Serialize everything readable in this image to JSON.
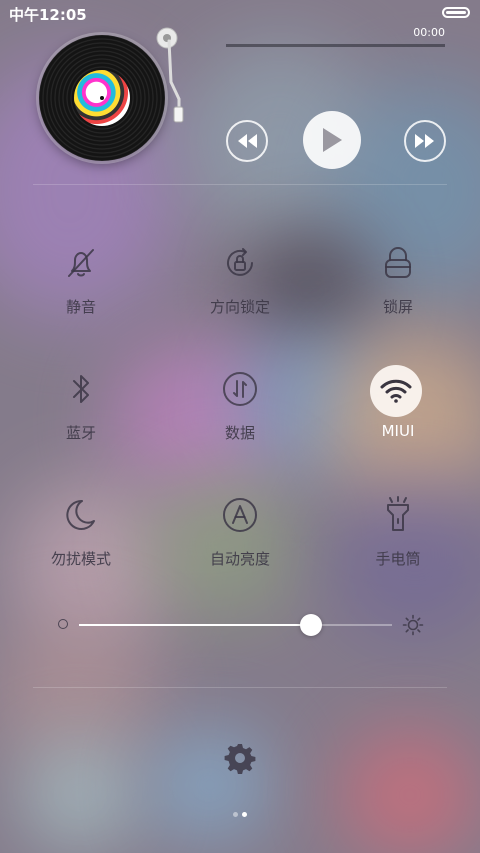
{
  "status_bar": {
    "time": "中午12:05"
  },
  "music": {
    "elapsed": "00:00",
    "progress": 0,
    "controls": {
      "prev_icon": "rewind-icon",
      "play_icon": "play-icon",
      "next_icon": "fast-forward-icon"
    }
  },
  "toggles": [
    {
      "label": "静音",
      "icon": "bell-off-icon",
      "active": false
    },
    {
      "label": "方向锁定",
      "icon": "rotation-lock-icon",
      "active": false
    },
    {
      "label": "锁屏",
      "icon": "lock-icon",
      "active": false
    },
    {
      "label": "蓝牙",
      "icon": "bluetooth-icon",
      "active": false
    },
    {
      "label": "数据",
      "icon": "mobile-data-icon",
      "active": false
    },
    {
      "label": "MIUI",
      "icon": "wifi-icon",
      "active": true
    },
    {
      "label": "勿扰模式",
      "icon": "moon-icon",
      "active": false
    },
    {
      "label": "自动亮度",
      "icon": "auto-brightness-icon",
      "active": false
    },
    {
      "label": "手电筒",
      "icon": "flashlight-icon",
      "active": false
    }
  ],
  "brightness": {
    "level": 0.74
  },
  "bottom": {
    "settings_icon": "gear-icon",
    "page_count": 2,
    "current_page": 2
  },
  "colors": {
    "accent": "#ffffff",
    "icon_inactive": "#3c3746",
    "active_bg": "#fffaf5"
  }
}
